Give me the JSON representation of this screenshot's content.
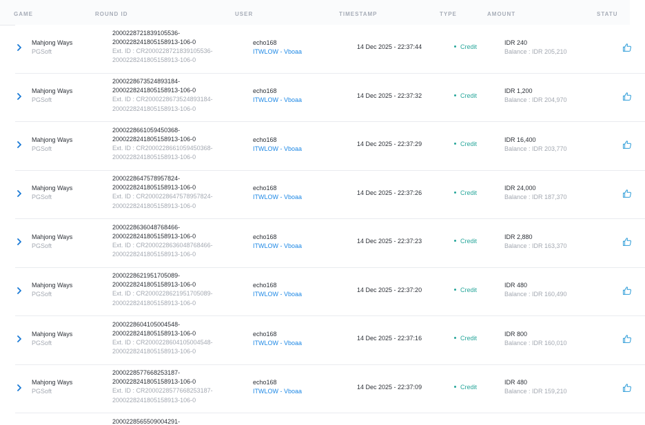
{
  "columns": {
    "game": "GAME",
    "round_id": "ROUND ID",
    "user": "USER",
    "timestamp": "TIMESTAMP",
    "type": "TYPE",
    "amount": "AMOUNT",
    "status": "STATU"
  },
  "rows": [
    {
      "game": "Mahjong Ways",
      "provider": "PGSoft",
      "round_id_1": "2000228721839105536-",
      "round_id_2": "2000228241805158913-106-0",
      "ext_1": "Ext. ID : CR2000228721839105536-",
      "ext_2": "2000228241805158913-106-0",
      "user": "echo168",
      "agent": "ITWLOW - Vboaa",
      "timestamp": "14 Dec 2025 - 22:37:44",
      "type": "Credit",
      "amount": "IDR 240",
      "balance": "Balance : IDR 205,210",
      "status_icon": "thumbs-up-icon"
    },
    {
      "game": "Mahjong Ways",
      "provider": "PGSoft",
      "round_id_1": "2000228673524893184-",
      "round_id_2": "2000228241805158913-106-0",
      "ext_1": "Ext. ID : CR2000228673524893184-",
      "ext_2": "2000228241805158913-106-0",
      "user": "echo168",
      "agent": "ITWLOW - Vboaa",
      "timestamp": "14 Dec 2025 - 22:37:32",
      "type": "Credit",
      "amount": "IDR 1,200",
      "balance": "Balance : IDR 204,970",
      "status_icon": "thumbs-up-icon"
    },
    {
      "game": "Mahjong Ways",
      "provider": "PGSoft",
      "round_id_1": "2000228661059450368-",
      "round_id_2": "2000228241805158913-106-0",
      "ext_1": "Ext. ID : CR2000228661059450368-",
      "ext_2": "2000228241805158913-106-0",
      "user": "echo168",
      "agent": "ITWLOW - Vboaa",
      "timestamp": "14 Dec 2025 - 22:37:29",
      "type": "Credit",
      "amount": "IDR 16,400",
      "balance": "Balance : IDR 203,770",
      "status_icon": "thumbs-up-icon"
    },
    {
      "game": "Mahjong Ways",
      "provider": "PGSoft",
      "round_id_1": "2000228647578957824-",
      "round_id_2": "2000228241805158913-106-0",
      "ext_1": "Ext. ID : CR2000228647578957824-",
      "ext_2": "2000228241805158913-106-0",
      "user": "echo168",
      "agent": "ITWLOW - Vboaa",
      "timestamp": "14 Dec 2025 - 22:37:26",
      "type": "Credit",
      "amount": "IDR 24,000",
      "balance": "Balance : IDR 187,370",
      "status_icon": "thumbs-up-icon"
    },
    {
      "game": "Mahjong Ways",
      "provider": "PGSoft",
      "round_id_1": "2000228636048768466-",
      "round_id_2": "2000228241805158913-106-0",
      "ext_1": "Ext. ID : CR2000228636048768466-",
      "ext_2": "2000228241805158913-106-0",
      "user": "echo168",
      "agent": "ITWLOW - Vboaa",
      "timestamp": "14 Dec 2025 - 22:37:23",
      "type": "Credit",
      "amount": "IDR 2,880",
      "balance": "Balance : IDR 163,370",
      "status_icon": "thumbs-up-icon"
    },
    {
      "game": "Mahjong Ways",
      "provider": "PGSoft",
      "round_id_1": "2000228621951705089-",
      "round_id_2": "2000228241805158913-106-0",
      "ext_1": "Ext. ID : CR2000228621951705089-",
      "ext_2": "2000228241805158913-106-0",
      "user": "echo168",
      "agent": "ITWLOW - Vboaa",
      "timestamp": "14 Dec 2025 - 22:37:20",
      "type": "Credit",
      "amount": "IDR 480",
      "balance": "Balance : IDR 160,490",
      "status_icon": "thumbs-up-icon"
    },
    {
      "game": "Mahjong Ways",
      "provider": "PGSoft",
      "round_id_1": "2000228604105004548-",
      "round_id_2": "2000228241805158913-106-0",
      "ext_1": "Ext. ID : CR2000228604105004548-",
      "ext_2": "2000228241805158913-106-0",
      "user": "echo168",
      "agent": "ITWLOW - Vboaa",
      "timestamp": "14 Dec 2025 - 22:37:16",
      "type": "Credit",
      "amount": "IDR 800",
      "balance": "Balance : IDR 160,010",
      "status_icon": "thumbs-up-icon"
    },
    {
      "game": "Mahjong Ways",
      "provider": "PGSoft",
      "round_id_1": "2000228577668253187-",
      "round_id_2": "2000228241805158913-106-0",
      "ext_1": "Ext. ID : CR2000228577668253187-",
      "ext_2": "2000228241805158913-106-0",
      "user": "echo168",
      "agent": "ITWLOW - Vboaa",
      "timestamp": "14 Dec 2025 - 22:37:09",
      "type": "Credit",
      "amount": "IDR 480",
      "balance": "Balance : IDR 159,210",
      "status_icon": "thumbs-up-icon"
    }
  ],
  "partial_row": {
    "round_id_1": "2000228565509004291-"
  },
  "colors": {
    "accent_link": "#1e88e5",
    "chevron": "#1a7ad6",
    "credit": "#26a69a",
    "muted": "#a3a8b1",
    "header_text": "#a6acb7"
  }
}
